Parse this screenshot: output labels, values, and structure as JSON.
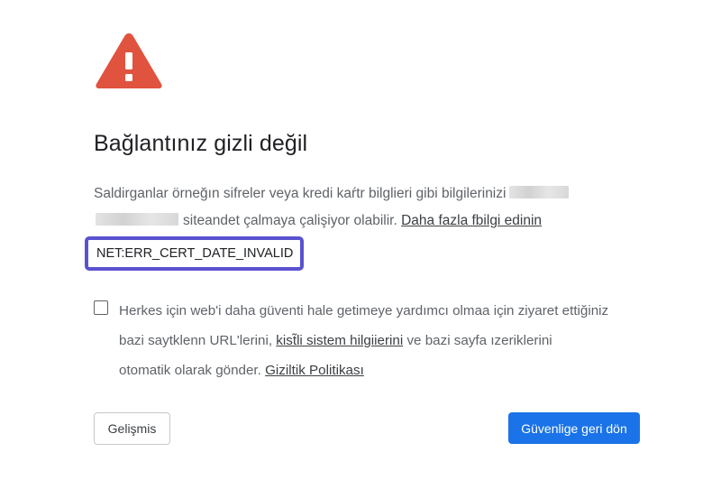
{
  "page": {
    "headline": "Bağlantınız gizli değil",
    "body": {
      "part1": "Saldirganlar örneğın sifreler veya kredi kaŕtr bilglieri gibi bilgilerinizi",
      "part2": "siteandet çalmaya çalişiyor olabilir.",
      "learn_more_link": "Daha fazla fbilgi edinin"
    },
    "error_code": "NET:ERR_CERT_DATE_INVALID",
    "optin": {
      "checked": false,
      "line1": "Herkes için web'i daha güventi hale getimeye yardımcı olmaa için ziyaret ettiğiniz",
      "line2_pre": "bazi saytklenn URL'lerini,",
      "system_info_link": "kist̃li sistem hilgiierini",
      "line2_post": "ve bazi sayfa ızeriklerini",
      "line3_pre": "otomatik olarak gönder.",
      "privacy_link": "Giziltik Politikası"
    },
    "buttons": {
      "advanced": "Gelişmis",
      "back_to_safety": "Güvenlige geri dön"
    }
  },
  "icons": {
    "warning": "warning-triangle-icon"
  },
  "colors": {
    "warning_red": "#e0533e",
    "primary_blue": "#1a73e8",
    "highlight_border": "#5a52cf"
  }
}
